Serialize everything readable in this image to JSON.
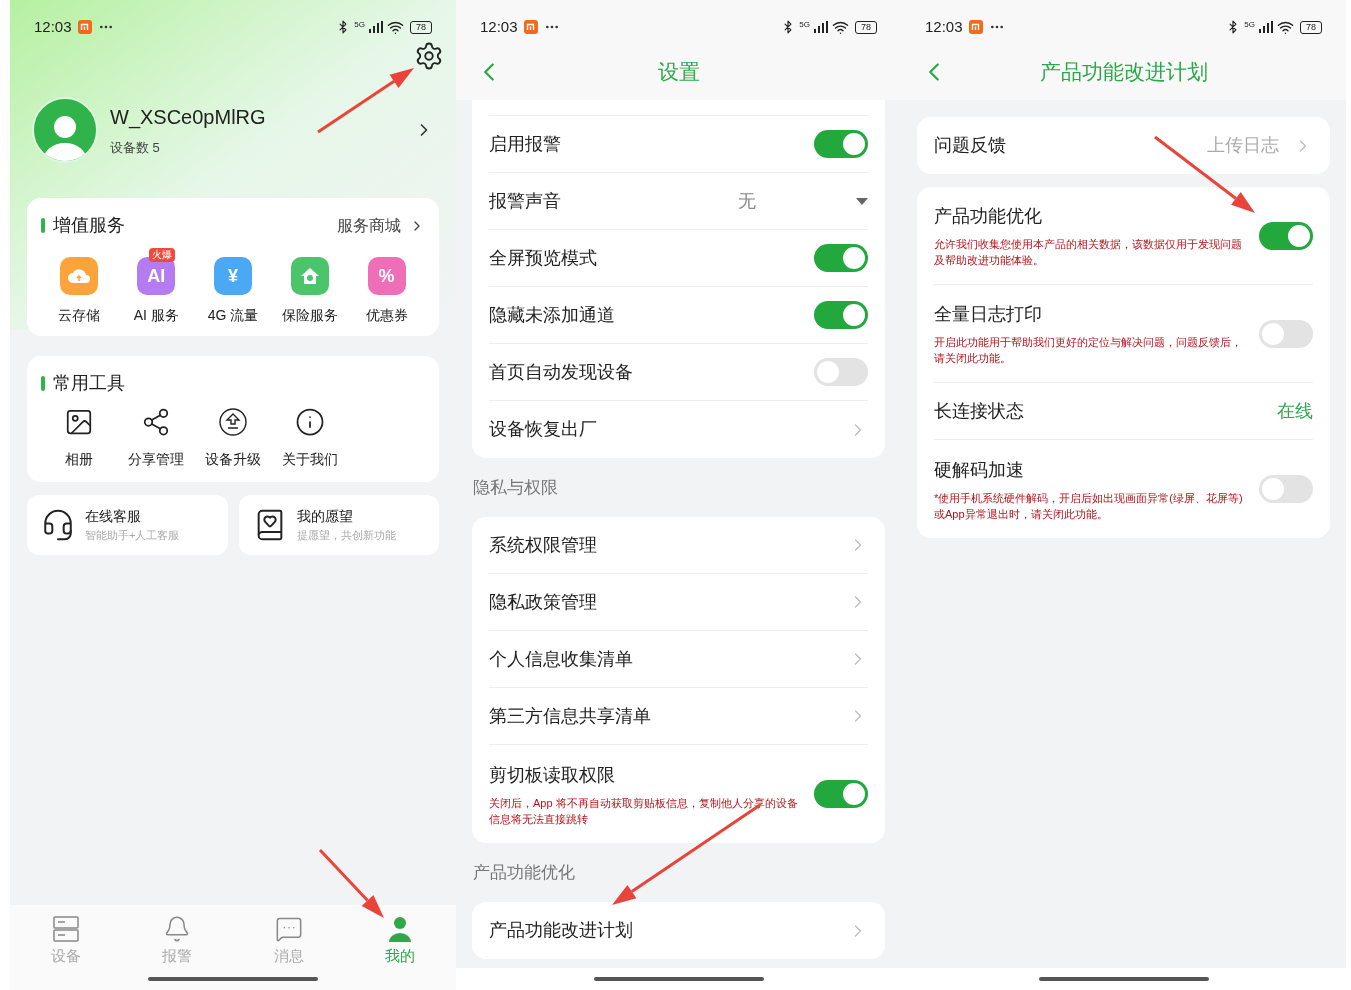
{
  "profile_screen": {
    "status_bar": {
      "time": "12:03",
      "network": "5G",
      "battery": "78"
    },
    "user": {
      "name": "W_XSCe0pMlRG",
      "device_count": "设备数 5"
    },
    "value_services": {
      "title": "增值服务",
      "link": "服务商城",
      "items": [
        {
          "label": "云存储",
          "kind": "cloud",
          "color": "#fba43c"
        },
        {
          "label": "AI 服务",
          "kind": "text",
          "icon_text": "AI",
          "badge": "火爆",
          "color": "#b47cf0"
        },
        {
          "label": "4G 流量",
          "kind": "text",
          "icon_text": "¥",
          "color": "#4aa8f5"
        },
        {
          "label": "保险服务",
          "kind": "house",
          "color": "#4cc46a"
        },
        {
          "label": "优惠券",
          "kind": "text",
          "icon_text": "%",
          "color": "#ee6fb8"
        }
      ]
    },
    "tools": {
      "title": "常用工具",
      "items": [
        {
          "label": "相册",
          "kind": "image"
        },
        {
          "label": "分享管理",
          "kind": "share"
        },
        {
          "label": "设备升级",
          "kind": "upgrade"
        },
        {
          "label": "关于我们",
          "kind": "info"
        }
      ]
    },
    "service_cards": [
      {
        "kind": "headset",
        "title": "在线客服",
        "subtitle": "智能助手+人工客服"
      },
      {
        "kind": "wish",
        "title": "我的愿望",
        "subtitle": "提愿望，共创新功能"
      }
    ],
    "tab_bar": [
      {
        "label": "设备",
        "kind": "device",
        "selected": false
      },
      {
        "label": "报警",
        "kind": "bell",
        "selected": false
      },
      {
        "label": "消息",
        "kind": "message",
        "selected": false
      },
      {
        "label": "我的",
        "kind": "user",
        "selected": true
      }
    ]
  },
  "settings_screen": {
    "status_bar": {
      "time": "12:03",
      "network": "5G",
      "battery": "78"
    },
    "title": "设置",
    "groups": [
      {
        "rows": [
          {
            "label": "启用报警",
            "kind": "toggle",
            "on": true
          },
          {
            "label": "报警声音",
            "kind": "select",
            "value": "无"
          },
          {
            "label": "全屏预览模式",
            "kind": "toggle",
            "on": true
          },
          {
            "label": "隐藏未添加通道",
            "kind": "toggle",
            "on": true
          },
          {
            "label": "首页自动发现设备",
            "kind": "toggle",
            "on": false
          },
          {
            "label": "设备恢复出厂",
            "kind": "link"
          }
        ]
      },
      {
        "heading": "隐私与权限",
        "rows": [
          {
            "label": "系统权限管理",
            "kind": "link"
          },
          {
            "label": "隐私政策管理",
            "kind": "link"
          },
          {
            "label": "个人信息收集清单",
            "kind": "link"
          },
          {
            "label": "第三方信息共享清单",
            "kind": "link"
          },
          {
            "label": "剪切板读取权限",
            "kind": "toggle",
            "on": true,
            "note": "关闭后，App 将不再自动获取剪贴板信息，复制他人分享的设备信息将无法直接跳转"
          }
        ]
      },
      {
        "heading": "产品功能优化",
        "rows": [
          {
            "label": "产品功能改进计划",
            "kind": "link"
          }
        ]
      }
    ]
  },
  "improvement_screen": {
    "status_bar": {
      "time": "12:03",
      "network": "5G",
      "battery": "78"
    },
    "title": "产品功能改进计划",
    "groups": [
      {
        "rows": [
          {
            "label": "问题反馈",
            "kind": "link",
            "value": "上传日志"
          }
        ]
      },
      {
        "rows": [
          {
            "label": "产品功能优化",
            "kind": "toggle",
            "on": true,
            "note": "允许我们收集您使用本产品的相关数据，该数据仅用于发现问题及帮助改进功能体验。"
          },
          {
            "label": "全量日志打印",
            "kind": "toggle",
            "on": false,
            "note": "开启此功能用于帮助我们更好的定位与解决问题，问题反馈后，请关闭此功能。"
          },
          {
            "label": "长连接状态",
            "kind": "status",
            "value": "在线"
          },
          {
            "label": "硬解码加速",
            "kind": "toggle",
            "on": false,
            "note": "*使用手机系统硬件解码，开启后如出现画面异常(绿屏、花屏等)或App异常退出时，请关闭此功能。"
          }
        ]
      }
    ]
  }
}
